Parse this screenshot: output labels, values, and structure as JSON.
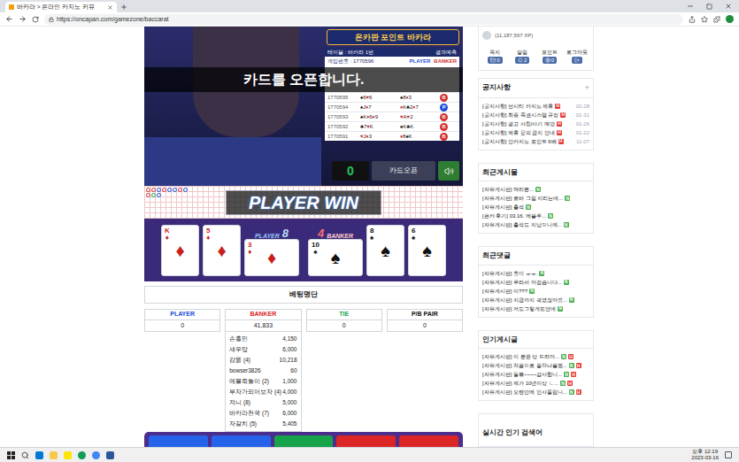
{
  "browser": {
    "tab_title": "바카라 > 온라인 카지노 커뮤",
    "url": "https://oncapan.com/gamezone/baccarat"
  },
  "game": {
    "logo": "온카판 포인트 바카라",
    "history": {
      "table_label": "테이블 : 바카라 1번",
      "predict_label": "결과예측",
      "game_no": "게임번호 : 1770596",
      "player_label": "PLAYER",
      "banker_label": "BANKER",
      "rows": [
        {
          "no": "1770595",
          "player": "♠6♥6",
          "banker": "♠8♦3",
          "result": "B",
          "color": "#d32f2f"
        },
        {
          "no": "1770594",
          "player": "♠J♦7",
          "banker": "♦K♣2♦7",
          "result": "P",
          "color": "#1d4ed8"
        },
        {
          "no": "1770593",
          "player": "♠K♦6♦9",
          "banker": "♥A♥2",
          "result": "B",
          "color": "#d32f2f"
        },
        {
          "no": "1770592",
          "player": "♣7♥K",
          "banker": "♠K♣K",
          "result": "B",
          "color": "#d32f2f"
        },
        {
          "no": "1770591",
          "player": "♥J♦3",
          "banker": "♦8♠K",
          "result": "B",
          "color": "#d32f2f"
        }
      ]
    },
    "banner": "카드를 오픈합니다.",
    "timer": "0",
    "open_button": "카드오픈",
    "bead_road": [
      [
        {
          "color": "#d32f2f"
        },
        {
          "color": "#d32f2f"
        },
        {
          "color": "#1d4ed8"
        },
        {
          "color": "#d32f2f"
        },
        {
          "color": "#1d4ed8"
        },
        {
          "color": "#1d4ed8"
        },
        {
          "color": "#d32f2f"
        },
        {
          "color": "#1d4ed8"
        }
      ],
      [
        {
          "color": "#d32f2f"
        },
        {
          "color": "#16a34a"
        },
        {
          "color": "#1d4ed8"
        }
      ]
    ],
    "result_banner": "PLAYER WIN",
    "player": {
      "label": "PLAYER",
      "score": "8",
      "cards": [
        {
          "rank": "K",
          "suit": "♦",
          "color": "#c81e1e",
          "kind": "upright"
        },
        {
          "rank": "5",
          "suit": "♦",
          "color": "#c81e1e",
          "kind": "upright"
        },
        {
          "rank": "3",
          "suit": "♦",
          "color": "#c81e1e",
          "kind": "sideways"
        }
      ]
    },
    "banker": {
      "label": "BANKER",
      "score": "4",
      "cards": [
        {
          "rank": "10",
          "suit": "♠",
          "color": "#111111",
          "kind": "sideways"
        },
        {
          "rank": "8",
          "suit": "♠",
          "color": "#111111",
          "kind": "upright"
        },
        {
          "rank": "6",
          "suit": "♠",
          "color": "#111111",
          "kind": "upright"
        }
      ]
    }
  },
  "bets": {
    "title": "베팅명단",
    "columns": [
      {
        "name": "PLAYER",
        "color": "#1d4ed8",
        "total": "0",
        "entries": []
      },
      {
        "name": "BANKER",
        "color": "#dc2626",
        "total": "41,833",
        "entries": [
          {
            "user": "손흥민",
            "amount": "4,150"
          },
          {
            "user": "새우탕",
            "amount": "6,000"
          },
          {
            "user": "감똥 (4)",
            "amount": "10,218"
          },
          {
            "user": "bowser3826",
            "amount": "60"
          },
          {
            "user": "에볼죽돌이 (2)",
            "amount": "1,000"
          },
          {
            "user": "부자가되어보자 (4)",
            "amount": "4,000"
          },
          {
            "user": "져니 (8)",
            "amount": "5,000"
          },
          {
            "user": "바카라천국 (7)",
            "amount": "6,000"
          },
          {
            "user": "자갈치 (5)",
            "amount": "5,405"
          }
        ]
      },
      {
        "name": "TIE",
        "color": "#16a34a",
        "total": "0",
        "entries": []
      },
      {
        "name": "P/B PAIR",
        "color": "#111111",
        "total": "0",
        "entries": []
      }
    ]
  },
  "sidebar": {
    "xp": "(11,187,567 XP)",
    "stats": [
      {
        "label": "쪽지",
        "count": "0",
        "kind": "mail"
      },
      {
        "label": "알림",
        "count": "2",
        "kind": "bell"
      },
      {
        "label": "포인트",
        "count": "0",
        "kind": "point"
      },
      {
        "label": "로그아웃",
        "count": "",
        "kind": "logout"
      }
    ],
    "sections": [
      {
        "title": "공지사항",
        "more": "+",
        "items": [
          {
            "text": "[공지사항] 선시티 카지노 제휴",
            "badges": [
              "H"
            ],
            "date": "02-28"
          },
          {
            "text": "[공지사항] 최종 룩권시스템 규정",
            "badges": [
              "H"
            ],
            "date": "01-31"
          },
          {
            "text": "[공지사항] 광고 사칭/사기 예방",
            "badges": [
              "H"
            ],
            "date": "01-26"
          },
          {
            "text": "[공지사항] 제휴 문의 금지 안내",
            "badges": [
              "H"
            ],
            "date": "01-22"
          },
          {
            "text": "[공지사항] 안카지노 포인트 6배",
            "badges": [
              "H"
            ],
            "date": "11-07"
          }
        ]
      },
      {
        "title": "최근게시물",
        "more": "",
        "items": [
          {
            "text": "[자유게시판] 여러분...",
            "badges": [
              "N"
            ],
            "date": ""
          },
          {
            "text": "[자유게시판] 로바 그림 지리는데...",
            "badges": [
              "N"
            ],
            "date": ""
          },
          {
            "text": "[자유게시판] 출석",
            "badges": [
              "N"
            ],
            "date": ""
          },
          {
            "text": "[온카 후기] 03.16. 에볼루...",
            "badges": [
              "N"
            ],
            "date": ""
          },
          {
            "text": "[자유게시판] 출석도 지났으니께...",
            "badges": [
              "N"
            ],
            "date": ""
          }
        ]
      },
      {
        "title": "최근댓글",
        "more": "",
        "items": [
          {
            "text": "[자유게시판] 호미 ㅠㅠ.",
            "badges": [
              "N"
            ],
            "date": ""
          },
          {
            "text": "[자유게시판] 루라서 아쉽습니다...",
            "badges": [
              "N"
            ],
            "date": ""
          },
          {
            "text": "[자유게시판] 이???",
            "badges": [
              "N"
            ],
            "date": ""
          },
          {
            "text": "[자유게시판] 지금까지 곽였잖아요...",
            "badges": [
              "N"
            ],
            "date": ""
          },
          {
            "text": "[자유게시판] 저도그렇게또먼데",
            "badges": [
              "N"
            ],
            "date": ""
          }
        ]
      },
      {
        "title": "인기게시글",
        "more": "",
        "items": [
          {
            "text": "[자유게시판] 이 분은 상 드려야...",
            "badges": [
              "N",
              "H"
            ],
            "date": ""
          },
          {
            "text": "[자유게시판] 처음으로 쓸하나볼겠...",
            "badges": [
              "N",
              "H"
            ],
            "date": ""
          },
          {
            "text": "[자유게시판] 들볶~~~~감사합니...",
            "badges": [
              "N",
              "H"
            ],
            "date": ""
          },
          {
            "text": "[자유게시판] 제가 10년이상 ㄴ...",
            "badges": [
              "N",
              "H"
            ],
            "date": ""
          },
          {
            "text": "[자유게시판] 오랜만에 인사올립니...",
            "badges": [
              "N",
              "H"
            ],
            "date": ""
          }
        ]
      }
    ],
    "trending_title": "실시간 인기 검색어"
  },
  "taskbar": {
    "time": "오후 12:19",
    "date": "2023-03-16"
  }
}
